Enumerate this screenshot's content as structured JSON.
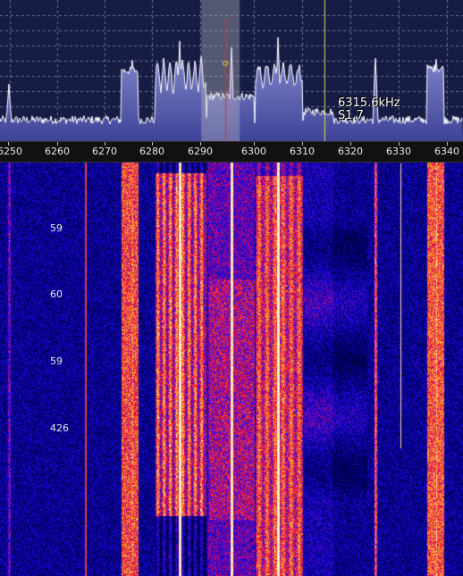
{
  "spectrum": {
    "background": "#161c44",
    "fill_color": "#6c72c8",
    "trace_color": "#ffffff",
    "grid_color": "#6a6f9a",
    "tuned_frequency_khz": 6295,
    "tuned_bandwidth_khz": [
      6290,
      6298
    ],
    "cursor_frequency_khz": 6315.6
  },
  "cursor_readout": {
    "frequency": "6315.6kHz",
    "level": "S1.7"
  },
  "frequency_axis": {
    "unit": "kHz",
    "range_khz": [
      6249,
      6342
    ],
    "ticks": [
      "6250",
      "6260",
      "6270",
      "6280",
      "6290",
      "6300",
      "6310",
      "6320",
      "6330",
      "6340"
    ]
  },
  "waterfall": {
    "labels": [
      "59",
      "60",
      "59",
      "426"
    ]
  }
}
